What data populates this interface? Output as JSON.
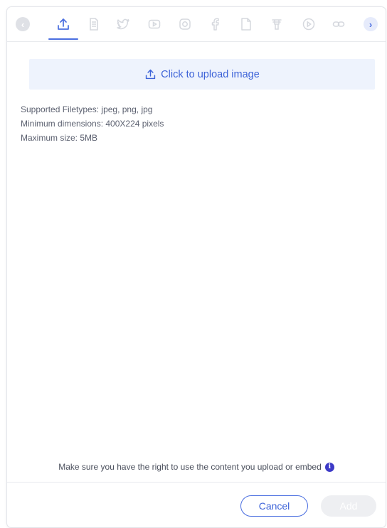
{
  "tabs": [
    {
      "icon": "upload-icon",
      "active": true
    },
    {
      "icon": "giphy-icon",
      "active": false
    },
    {
      "icon": "twitter-icon",
      "active": false
    },
    {
      "icon": "youtube-icon",
      "active": false
    },
    {
      "icon": "instagram-icon",
      "active": false
    },
    {
      "icon": "facebook-icon",
      "active": false
    },
    {
      "icon": "document-icon",
      "active": false
    },
    {
      "icon": "widget-icon",
      "active": false
    },
    {
      "icon": "video-play-icon",
      "active": false
    },
    {
      "icon": "link-icon",
      "active": false
    }
  ],
  "nav": {
    "prev_glyph": "‹",
    "next_glyph": "›"
  },
  "upload": {
    "label": "Click to upload image"
  },
  "info": {
    "filetypes": "Supported Filetypes: jpeg, png, jpg",
    "dimensions": "Minimum dimensions: 400X224 pixels",
    "max_size": "Maximum size: 5MB"
  },
  "footer": {
    "rights_note": "Make sure you have the right to use the content you upload or embed",
    "info_glyph": "i",
    "cancel_label": "Cancel",
    "add_label": "Add"
  },
  "colors": {
    "accent": "#4a6ee0",
    "upload_bg": "#eef3fd",
    "inactive_icon": "#d5d8de",
    "info_icon": "#3d3ac7"
  }
}
